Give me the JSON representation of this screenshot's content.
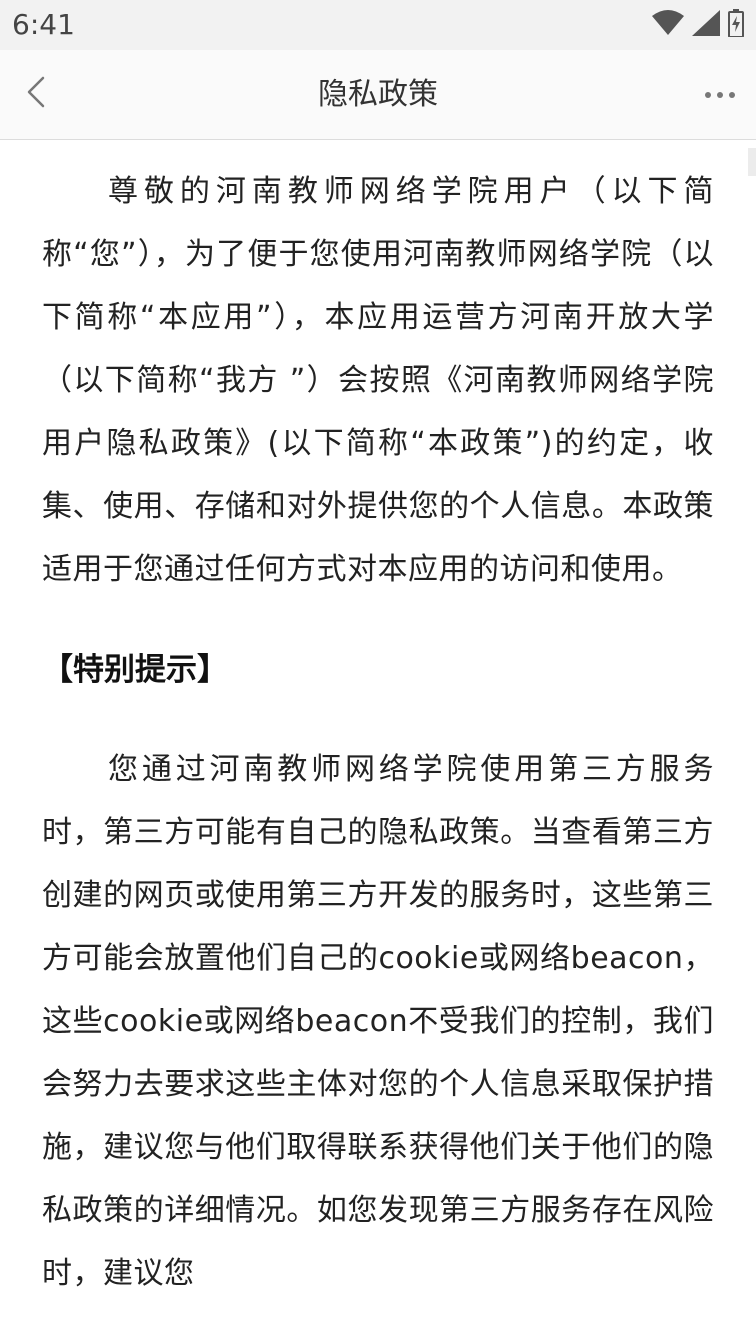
{
  "status_bar": {
    "time": "6:41",
    "icons": [
      "wifi-icon",
      "cellular-signal-icon",
      "battery-charging-icon"
    ]
  },
  "header": {
    "title": "隐私政策",
    "back_icon": "chevron-left-icon",
    "more_icon": "more-horizontal-icon"
  },
  "content": {
    "intro": "尊敬的河南教师网络学院用户（以下简称“您”），为了便于您使用河南教师网络学院（以下简称“本应用”），本应用运营方河南开放大学（以下简称“我方 ”）会按照《河南教师网络学院用户隐私政策》(以下简称“本政策”)的约定，收集、使用、存储和对外提供您的个人信息。本政策适用于您通过任何方式对本应用的访问和使用。",
    "section_heading": "【特别提示】",
    "third_party": "您通过河南教师网络学院使用第三方服务时，第三方可能有自己的隐私政策。当查看第三方创建的网页或使用第三方开发的服务时，这些第三方可能会放置他们自己的cookie或网络beacon，这些cookie或网络beacon不受我们的控制，我们会努力去要求这些主体对您的个人信息采取保护措施，建议您与他们取得联系获得他们关于他们的隐私政策的详细情况。如您发现第三方服务存在风险时，建议您"
  },
  "colors": {
    "status_bar_bg": "#f2f2f2",
    "header_bg": "#fafafa",
    "text": "#222222",
    "icon": "#666666"
  }
}
